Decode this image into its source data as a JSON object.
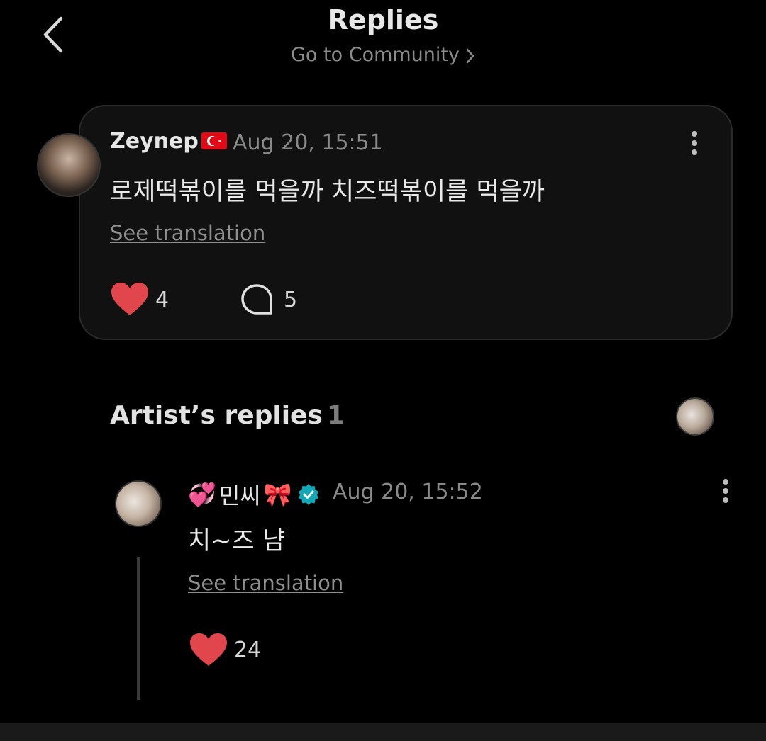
{
  "header": {
    "title": "Replies",
    "community_link": "Go to Community",
    "back_icon": "chevron-left-icon"
  },
  "post": {
    "author": "Zeynep",
    "author_flag": "🇹🇷",
    "timestamp": "Aug 20, 15:51",
    "text": "로제떡볶이를 먹을까 치즈떡볶이를 먹을까",
    "see_translation": "See translation",
    "likes": "4",
    "comments": "5",
    "like_color": "#e0464c"
  },
  "artist_replies": {
    "title": "Artist’s replies",
    "count": "1"
  },
  "reply": {
    "author_prefix": "💞",
    "author_name": "민씨",
    "author_suffix": "🎀",
    "verified_color": "#13a8b5",
    "timestamp": "Aug 20, 15:52",
    "text": "치~즈 냠",
    "see_translation": "See translation",
    "likes": "24"
  }
}
